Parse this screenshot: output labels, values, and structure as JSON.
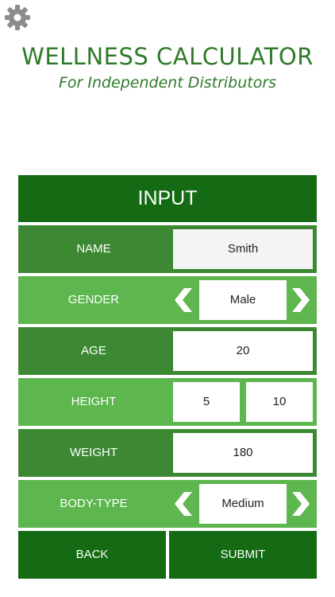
{
  "header": {
    "settings_icon": "gear-icon",
    "title": "WELLNESS CALCULATOR",
    "subtitle": "For Independent Distributors"
  },
  "form": {
    "section_title": "INPUT",
    "name": {
      "label": "NAME",
      "value": "Smith"
    },
    "gender": {
      "label": "GENDER",
      "value": "Male",
      "prev_icon": "chevron-left-icon",
      "next_icon": "chevron-right-icon"
    },
    "age": {
      "label": "AGE",
      "value": "20"
    },
    "height": {
      "label": "HEIGHT",
      "feet": "5",
      "inches": "10"
    },
    "weight": {
      "label": "WEIGHT",
      "value": "180"
    },
    "body_type": {
      "label": "BODY-TYPE",
      "value": "Medium",
      "prev_icon": "chevron-left-icon",
      "next_icon": "chevron-right-icon"
    }
  },
  "actions": {
    "back_label": "BACK",
    "submit_label": "SUBMIT"
  },
  "colors": {
    "brand_green": "#2f7a2a",
    "header_green": "#146b14",
    "row_dark": "#3d8933",
    "row_light": "#5db64e",
    "gear_grey": "#8c8c8c"
  }
}
